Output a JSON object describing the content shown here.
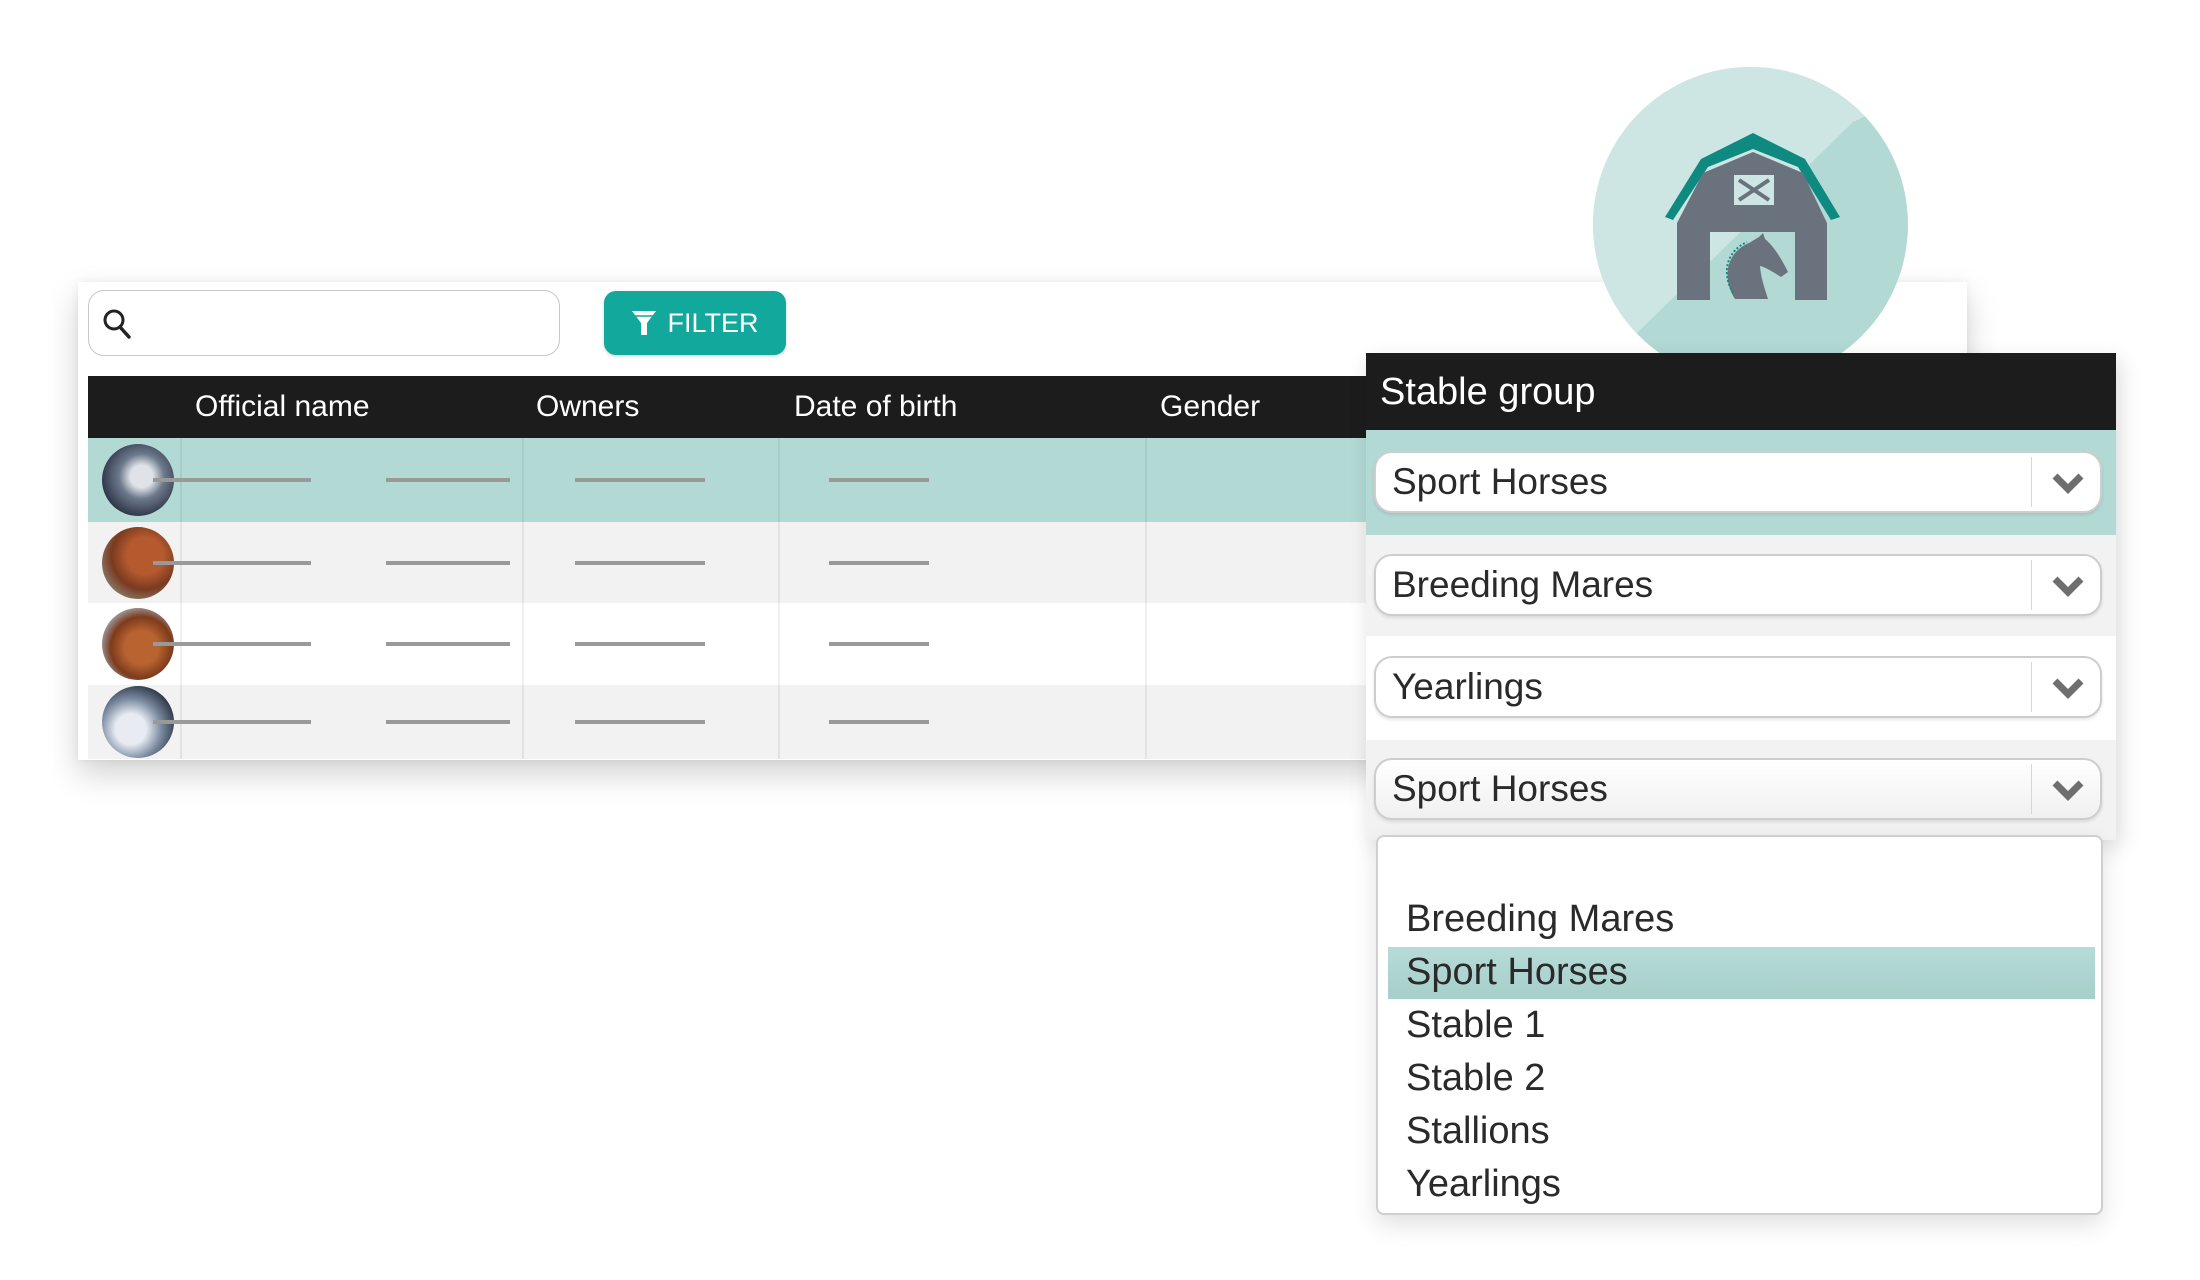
{
  "toolbar": {
    "search_placeholder": "",
    "search_value": "",
    "filter_label": "FILTER"
  },
  "table": {
    "columns": [
      "",
      "Official name",
      "Owners",
      "Date of birth",
      "Gender"
    ],
    "rows": [
      {
        "avatar": "grey-horse",
        "selected": true,
        "official_name": "",
        "owners": "",
        "date_of_birth": "",
        "gender": ""
      },
      {
        "avatar": "chestnut-horse",
        "selected": false,
        "official_name": "",
        "owners": "",
        "date_of_birth": "",
        "gender": ""
      },
      {
        "avatar": "chestnut-horse-field",
        "selected": false,
        "official_name": "",
        "owners": "",
        "date_of_birth": "",
        "gender": ""
      },
      {
        "avatar": "bay-horse-stall",
        "selected": false,
        "official_name": "",
        "owners": "",
        "date_of_birth": "",
        "gender": ""
      }
    ]
  },
  "stable_group": {
    "title": "Stable group",
    "icon": "barn-horse-icon",
    "selects": [
      "Sport Horses",
      "Breeding Mares",
      "Yearlings",
      "Sport Horses"
    ],
    "dropdown": {
      "options": [
        "",
        "Breeding Mares",
        "Sport Horses",
        "Stable 1",
        "Stable 2",
        "Stallions",
        "Yearlings"
      ],
      "selected": "Sport Horses"
    }
  },
  "colors": {
    "accent": "#12a99c",
    "selected_row": "#b3d9d5",
    "header_bg": "#1c1c1c",
    "alt_row": "#f2f2f2",
    "barn_gray": "#6a737d",
    "barn_roof": "#0f8a80"
  }
}
